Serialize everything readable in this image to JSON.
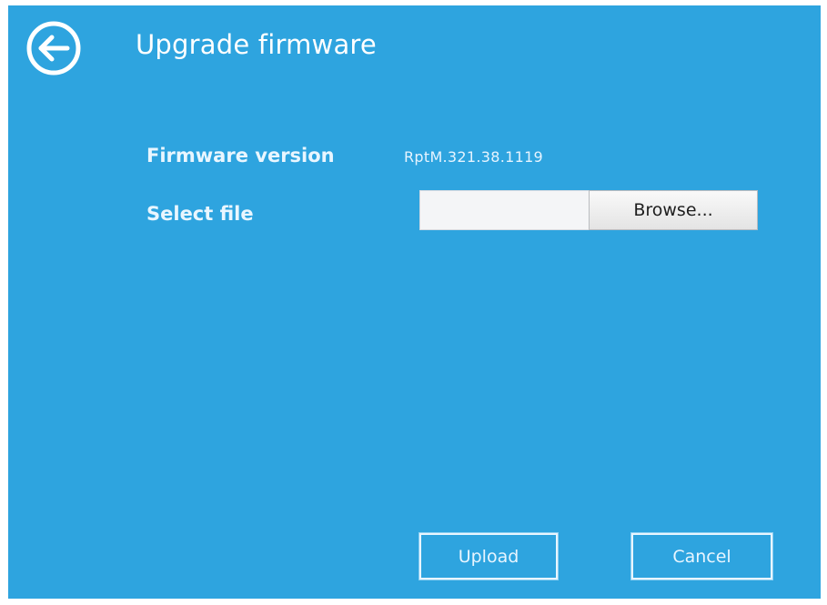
{
  "header": {
    "title": "Upgrade firmware"
  },
  "form": {
    "firmware_label": "Firmware version",
    "firmware_value": "RptM.321.38.1119",
    "select_file_label": "Select file",
    "file_value": "",
    "browse_label": "Browse..."
  },
  "actions": {
    "upload_label": "Upload",
    "cancel_label": "Cancel"
  },
  "icons": {
    "back": "arrow-left-circle-icon"
  },
  "colors": {
    "background": "#2ea4df",
    "text": "#ffffff",
    "browse_button": "#ececec"
  }
}
